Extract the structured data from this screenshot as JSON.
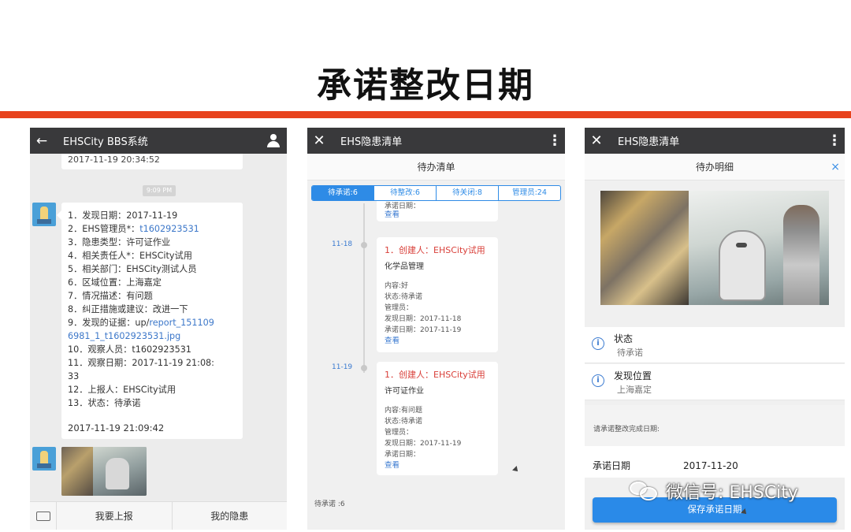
{
  "slide": {
    "title": "承诺整改日期"
  },
  "watermark": {
    "text": "微信号: EHSCity"
  },
  "phone1": {
    "title": "EHSCity BBS系统",
    "prev_time": "2017-11-19 20:34:52",
    "time_chip": "9:09 PM",
    "message_lines": [
      {
        "prefix": "1．发现日期：2017-11-19",
        "link": ""
      },
      {
        "prefix": "2．EHS管理员*：",
        "link": "t1602923531"
      },
      {
        "prefix": "3．隐患类型：许可证作业",
        "link": ""
      },
      {
        "prefix": "4．相关责任人*：EHSCity试用",
        "link": ""
      },
      {
        "prefix": "5．相关部门：EHSCity测试人员",
        "link": ""
      },
      {
        "prefix": "6．区域位置：上海嘉定",
        "link": ""
      },
      {
        "prefix": "7．情况描述：有问题",
        "link": ""
      },
      {
        "prefix": "8．纠正措施或建议：改进一下",
        "link": ""
      },
      {
        "prefix": "9．发现的证据：up/",
        "link": "report_151109"
      },
      {
        "prefix": "",
        "link": "6981_1_t1602923531.jpg"
      },
      {
        "prefix": "10．观察人员：t1602923531",
        "link": ""
      },
      {
        "prefix": "11．观察日期：2017-11-19 21:08:",
        "link": ""
      },
      {
        "prefix": "33",
        "link": ""
      },
      {
        "prefix": "12．上报人：EHSCity试用",
        "link": ""
      },
      {
        "prefix": "13．状态：待承诺",
        "link": ""
      }
    ],
    "message_time": "2017-11-19 21:09:42",
    "bottom_left": "我要上报",
    "bottom_right": "我的隐患"
  },
  "phone2": {
    "title": "EHS隐患清单",
    "subheader": "待办清单",
    "tabs": [
      {
        "label": "待承诺:6",
        "active": true
      },
      {
        "label": "待整改:6",
        "active": false
      },
      {
        "label": "待关闭:8",
        "active": false
      },
      {
        "label": "管理员:24",
        "active": false
      }
    ],
    "partial_card": {
      "line": "承诺日期：",
      "link": "查看"
    },
    "entries": [
      {
        "date": "11-18",
        "title": "1．创建人：EHSCity试用",
        "type": "化学品管理",
        "lines": [
          "内容:好",
          "状态:待承诺",
          "管理员：",
          "发现日期：2017-11-18",
          "承诺日期：2017-11-19"
        ],
        "link": "查看"
      },
      {
        "date": "11-19",
        "title": "1．创建人：EHSCity试用",
        "type": "许可证作业",
        "lines": [
          "内容:有问题",
          "状态:待承诺",
          "管理员：",
          "发现日期：2017-11-19",
          "承诺日期："
        ],
        "link": "查看"
      }
    ],
    "footer": "待承诺 :6"
  },
  "phone3": {
    "title": "EHS隐患清单",
    "subheader": "待办明细",
    "close_symbol": "×",
    "status_label": "状态",
    "status_value": "待承诺",
    "location_label": "发现位置",
    "location_value": "上海嘉定",
    "prompt": "请承诺整改完成日期:",
    "date_label": "承诺日期",
    "date_value": "2017-11-20",
    "save_label": "保存承诺日期"
  },
  "colors": {
    "accent_red": "#e8421c",
    "topbar": "#39393b",
    "primary_blue": "#2a8ae8",
    "link_blue": "#3a7ad0",
    "creator_red": "#d9403a"
  }
}
